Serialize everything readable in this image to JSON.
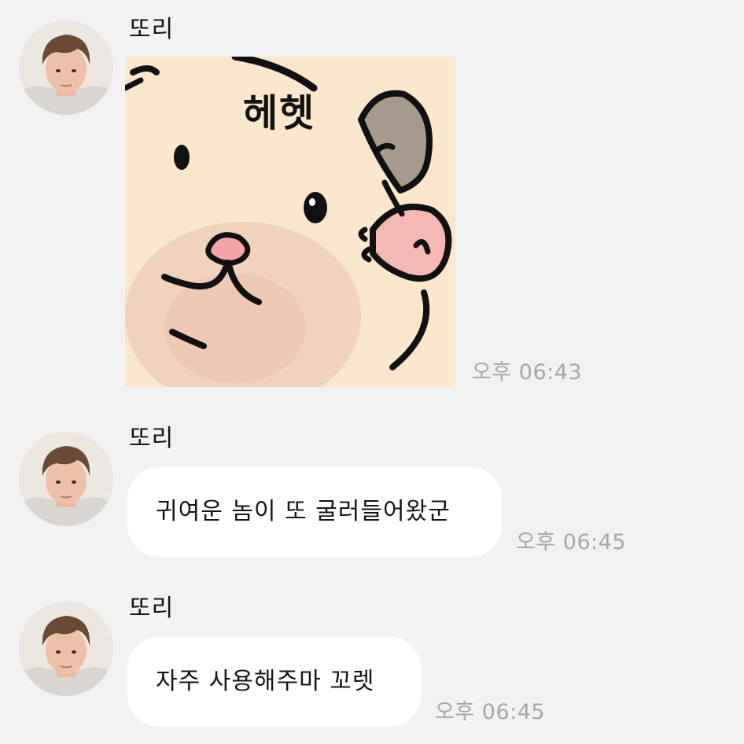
{
  "messages": [
    {
      "sender": "또리",
      "type": "sticker",
      "sticker_text": "헤헷",
      "time": "오후 06:43"
    },
    {
      "sender": "또리",
      "type": "text",
      "text": "귀여운 놈이 또 굴러들어왔군",
      "time": "오후 06:45"
    },
    {
      "sender": "또리",
      "type": "text",
      "text": "자주 사용해주마 꼬렛",
      "time": "오후 06:45"
    }
  ],
  "colors": {
    "background": "#f2f2f2",
    "bubble": "#ffffff",
    "timestamp": "#a7a7a7",
    "sticker_fur": "#fbe8cc",
    "sticker_ear": "#a59a8c",
    "sticker_nose": "#f4a6a6"
  },
  "icons": {
    "avatar": "profile-photo",
    "sticker": "hamster-sticker"
  }
}
